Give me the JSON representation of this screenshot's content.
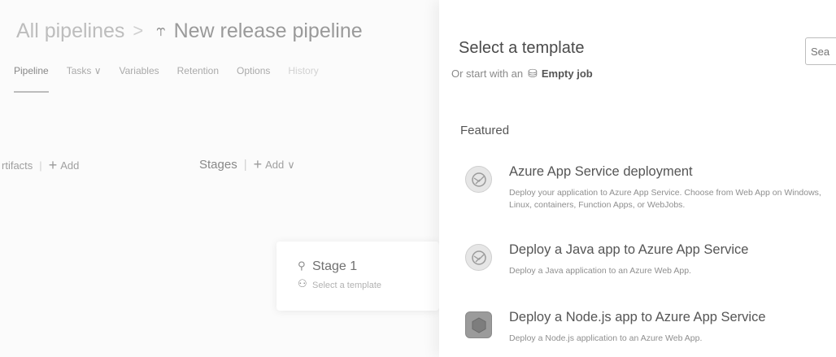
{
  "header": {
    "breadcrumb_parent": "All pipelines",
    "separator": ">",
    "pipeline_icon": "pipeline-icon",
    "pipeline_name": "New release pipeline"
  },
  "tabs": [
    {
      "label": "Pipeline"
    },
    {
      "label": "Tasks ∨"
    },
    {
      "label": "Variables"
    },
    {
      "label": "Retention"
    },
    {
      "label": "Options"
    },
    {
      "label": "History"
    }
  ],
  "canvas": {
    "artifacts_label": "rtifacts",
    "artifacts_add": "Add",
    "stages_label": "Stages",
    "stages_add": "Add",
    "stage_card": {
      "name": "Stage 1",
      "subtitle": "Select a template",
      "icons": [
        "deploy-icon",
        "person-icon"
      ]
    }
  },
  "panel": {
    "title": "Select a template",
    "start_prefix": "Or start with an",
    "empty_job_label": "Empty job",
    "search_placeholder": "Sea",
    "featured_label": "Featured",
    "templates": [
      {
        "title": "Azure App Service deployment",
        "description": "Deploy your application to Azure App Service. Choose from Web App on Windows, Linux, containers, Function Apps, or WebJobs.",
        "icon": "app-service-icon"
      },
      {
        "title": "Deploy a Java app to Azure App Service",
        "description": "Deploy a Java application to an Azure Web App.",
        "icon": "app-service-icon"
      },
      {
        "title": "Deploy a Node.js app to Azure App Service",
        "description": "Deploy a Node.js application to an Azure Web App.",
        "icon": "nodejs-icon"
      }
    ]
  }
}
